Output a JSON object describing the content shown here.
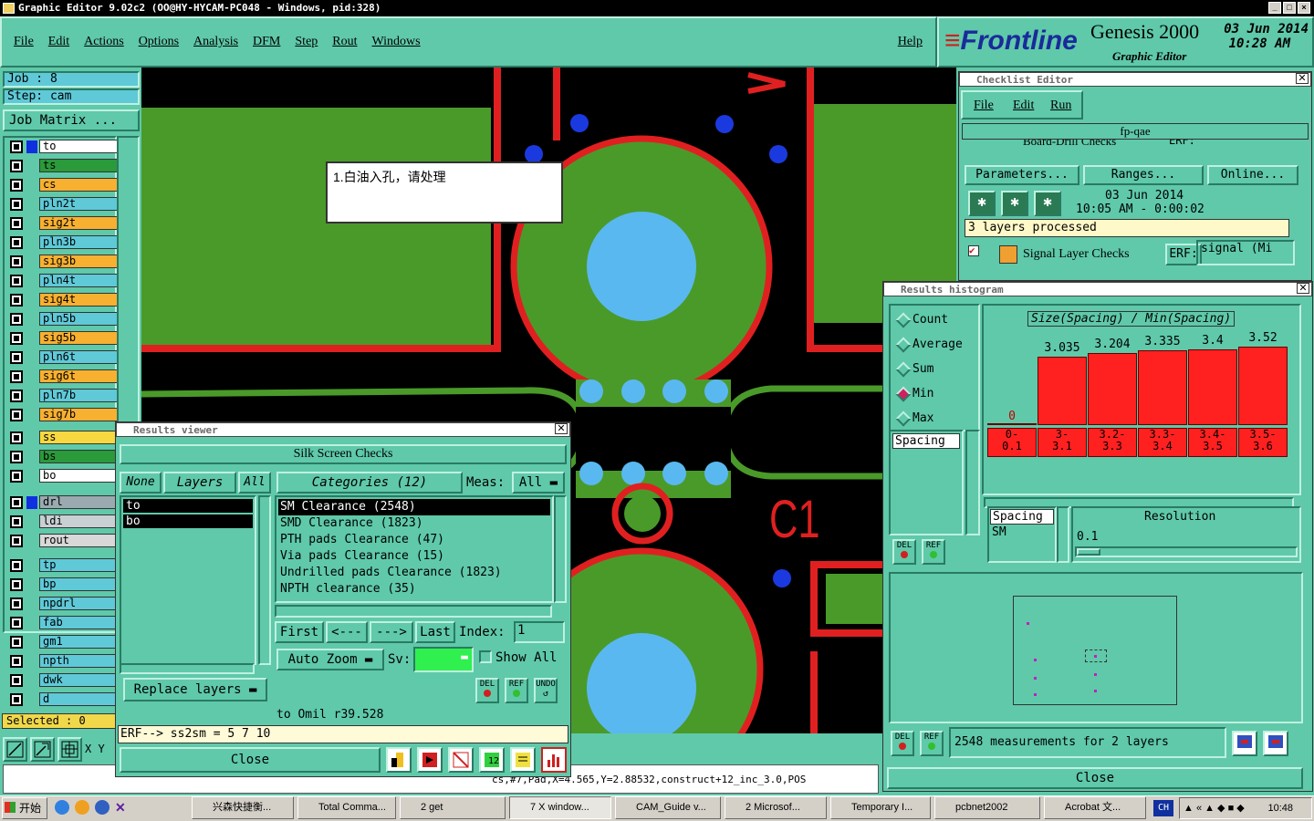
{
  "window_title": "Graphic Editor 9.02c2 (OO@HY-HYCAM-PC048 - Windows, pid:328)",
  "menu": [
    "File",
    "Edit",
    "Actions",
    "Options",
    "Analysis",
    "DFM",
    "Step",
    "Rout",
    "Windows"
  ],
  "help": "Help",
  "brand": {
    "logo": "Frontline",
    "product": "Genesis 2000",
    "sub": "Graphic Editor",
    "date": "03 Jun 2014",
    "time": "10:28 AM"
  },
  "job": {
    "job": "Job : 8",
    "step": "Step: cam",
    "matrix": "Job Matrix ..."
  },
  "layers": [
    {
      "name": "to",
      "color": "#ffffff",
      "sel": true
    },
    {
      "name": "ts",
      "color": "#2a9a3a"
    },
    {
      "name": "cs",
      "color": "#f8b030"
    },
    {
      "name": "pln2t",
      "color": "#5fc9d8"
    },
    {
      "name": "sig2t",
      "color": "#f8b030"
    },
    {
      "name": "pln3b",
      "color": "#5fc9d8"
    },
    {
      "name": "sig3b",
      "color": "#f8b030"
    },
    {
      "name": "pln4t",
      "color": "#5fc9d8"
    },
    {
      "name": "sig4t",
      "color": "#f8b030"
    },
    {
      "name": "pln5b",
      "color": "#5fc9d8"
    },
    {
      "name": "sig5b",
      "color": "#f8b030"
    },
    {
      "name": "pln6t",
      "color": "#5fc9d8"
    },
    {
      "name": "sig6t",
      "color": "#f8b030"
    },
    {
      "name": "pln7b",
      "color": "#5fc9d8"
    },
    {
      "name": "sig7b",
      "color": "#f8b030"
    },
    {
      "name": "ss",
      "color": "#f8d840"
    },
    {
      "name": "bs",
      "color": "#2a9a3a"
    },
    {
      "name": "bo",
      "color": "#ffffff"
    },
    {
      "name": "drl",
      "color": "#9aaab0"
    },
    {
      "name": "ldi",
      "color": "#c8d0d4"
    },
    {
      "name": "rout",
      "color": "#d8d8d8"
    },
    {
      "name": "tp",
      "color": "#5fc9d8"
    },
    {
      "name": "bp",
      "color": "#5fc9d8"
    },
    {
      "name": "npdrl",
      "color": "#5fc9d8"
    },
    {
      "name": "fab",
      "color": "#5fc9d8"
    },
    {
      "name": "gm1",
      "color": "#5fc9d8"
    },
    {
      "name": "npth",
      "color": "#5fc9d8"
    },
    {
      "name": "dwk",
      "color": "#5fc9d8"
    },
    {
      "name": "d",
      "color": "#5fc9d8"
    }
  ],
  "selected": "Selected : 0",
  "xy": "X Y",
  "note": "1.白油入孔，请处理",
  "c1": "C1",
  "status_coords": "cs,#7,Pad,X=4.565,Y=2.88532,construct+12_inc_3.0,POS",
  "checklist": {
    "title": "Checklist Editor",
    "menu": [
      "File",
      "Edit",
      "Run"
    ],
    "name": "fp-qae",
    "item1": "Board-Drill Checks",
    "erf": "ERF:",
    "params": "Parameters...",
    "ranges": "Ranges...",
    "online": "Online...",
    "date": "03 Jun 2014",
    "time": "10:05 AM - 0:00:02",
    "processed": "3 layers processed",
    "item2": "Signal Layer Checks",
    "erf2": "ERF:",
    "erfval": "signal (Mi"
  },
  "histogram": {
    "title": "Results histogram",
    "modes": [
      "Count",
      "Average",
      "Sum",
      "Min",
      "Max"
    ],
    "selected": "Min",
    "header": "Size(Spacing) / Min(Spacing)",
    "list1": "Spacing",
    "list2a": "Spacing",
    "list2b": "SM",
    "resolution_label": "Resolution",
    "resolution": "0.1",
    "summary": "2548 measurements for 2 layers",
    "close": "Close",
    "del": "DEL",
    "ref": "REF",
    "bars": [
      {
        "label": "0",
        "range": "0-\n0.1",
        "value": 0
      },
      {
        "label": "3.035",
        "range": "3-\n3.1",
        "value": 3.035
      },
      {
        "label": "3.204",
        "range": "3.2-\n3.3",
        "value": 3.204
      },
      {
        "label": "3.335",
        "range": "3.3-\n3.4",
        "value": 3.335
      },
      {
        "label": "3.4",
        "range": "3.4-\n3.5",
        "value": 3.4
      },
      {
        "label": "3.52",
        "range": "3.5-\n3.6",
        "value": 3.52
      }
    ]
  },
  "results": {
    "title": "Results viewer",
    "header": "Silk Screen Checks",
    "none": "None",
    "layers_btn": "Layers",
    "all": "All",
    "layers": [
      "to",
      "bo"
    ],
    "categories": "Categories (12)",
    "meas": "Meas:",
    "meas_val": "All",
    "items": [
      "SM Clearance (2548)",
      "SMD Clearance (1823)",
      "PTH pads Clearance (47)",
      "Via pads Clearance (15)",
      "Undrilled pads Clearance (1823)",
      "NPTH clearance (35)"
    ],
    "first": "First",
    "prev": "<---",
    "next": "--->",
    "last": "Last",
    "index": "Index:",
    "index_val": "1",
    "autozoom": "Auto Zoom",
    "sv": "Sv:",
    "showall": "Show All",
    "replace": "Replace layers",
    "del": "DEL",
    "ref": "REF",
    "undo": "UNDO",
    "status": "to Omil r39.528",
    "erf": "ERF--> ss2sm = 5 7 10",
    "close": "Close"
  },
  "taskbar": {
    "start": "开始",
    "items": [
      "兴森快捷衡...",
      "Total Comma...",
      "2 get",
      "7 X window...",
      "CAM_Guide v...",
      "2 Microsof...",
      "Temporary I...",
      "pcbnet2002",
      "Acrobat 文..."
    ],
    "lang": "CH",
    "clock": "10:48"
  }
}
